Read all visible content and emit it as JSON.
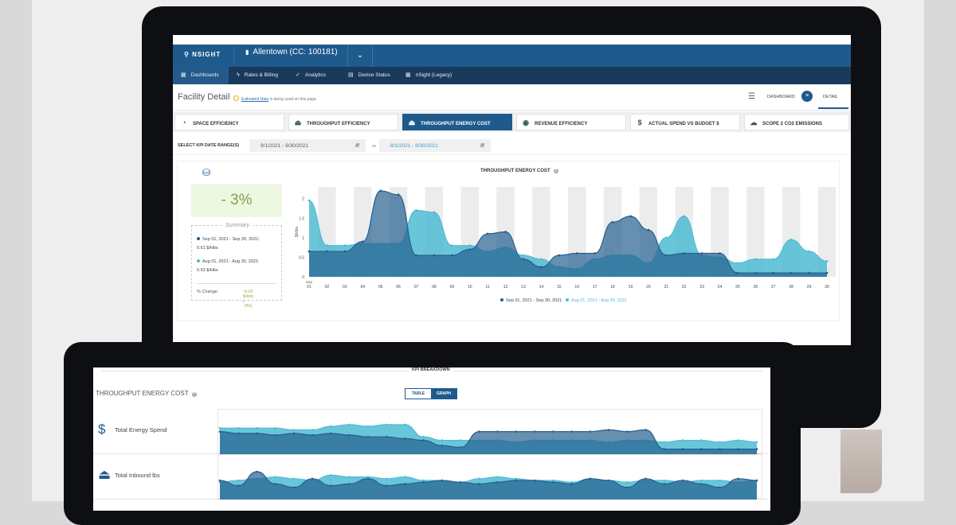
{
  "topbar": {
    "brand": "NSIGHT",
    "facility": "Allentown (CC: 100181)"
  },
  "nav": [
    {
      "label": "Dashboards",
      "active": true
    },
    {
      "label": "Rates & Billing"
    },
    {
      "label": "Analytics"
    },
    {
      "label": "Device Status"
    },
    {
      "label": "nSight (Legacy)"
    }
  ],
  "page": {
    "title": "Facility Detail",
    "estimated_link": "Estimated Data",
    "estimated_rest": " is being used on this page.",
    "dashboard": "DASHBOARD",
    "detail": "DETAIL"
  },
  "kpi_tabs": [
    {
      "label": "SPACE EFFICIENCY",
      "icon": "gauge-icon"
    },
    {
      "label": "THROUGHPUT EFFICIENCY",
      "icon": "weight-icon"
    },
    {
      "label": "THROUGHPUT ENERGY COST",
      "icon": "weight-dollar-icon",
      "active": true
    },
    {
      "label": "REVENUE EFFICIENCY",
      "icon": "coin-icon"
    },
    {
      "label": "ACTUAL SPEND VS BUDGET $",
      "icon": "dollar-icon"
    },
    {
      "label": "SCOPE 2 CO2 EMISSIONS",
      "icon": "cloud-icon"
    }
  ],
  "date": {
    "label": "SELECT KPI DATE RANGE(S)",
    "range1": "9/1/2021  -  9/30/2021",
    "vs": "vs",
    "range2": "8/1/2021  -  8/30/2021"
  },
  "summary": {
    "change": "- 3%",
    "title": "Summary",
    "s1_range": "Sep 01, 2021 - Sep 30, 2021:",
    "s1_value": "0.61 $/klbs",
    "s2_range": "Aug 01, 2021 - Aug 30, 2021:",
    "s2_value": "0.63 $/klbs",
    "pct_label": "% Change:",
    "pct_value": "-0.02 $/kbs ( -3%)"
  },
  "colors": {
    "primary": "#1f5a8d",
    "series1": "#25608f",
    "series2": "#4fbcd2",
    "nav": "#1a3a5c"
  },
  "chart_data": {
    "type": "area",
    "title": "THROUGHPUT ENERGY COST",
    "xlabel": "",
    "ylabel": "$/klbs",
    "x": [
      "01",
      "02",
      "03",
      "04",
      "05",
      "06",
      "07",
      "08",
      "09",
      "10",
      "11",
      "12",
      "13",
      "14",
      "15",
      "16",
      "17",
      "18",
      "19",
      "20",
      "21",
      "22",
      "23",
      "24",
      "25",
      "26",
      "27",
      "28",
      "29",
      "30"
    ],
    "ylim": [
      0,
      2.3
    ],
    "yticks": [
      0,
      0.5,
      1,
      1.5,
      2
    ],
    "x_prefix": "Sep",
    "series": [
      {
        "name": "Sep 01, 2021 - Sep 30, 2021",
        "color": "#25608f",
        "values": [
          0.65,
          0.65,
          0.65,
          0.9,
          2.2,
          2.1,
          0.55,
          0.55,
          0.55,
          0.7,
          1.1,
          1.15,
          0.45,
          0.25,
          0.55,
          0.6,
          0.6,
          1.4,
          1.55,
          1.2,
          0.55,
          0.6,
          0.6,
          0.6,
          0.1,
          0.1,
          0.1,
          0.1,
          0.1,
          0.1
        ]
      },
      {
        "name": "Aug 01, 2021 - Aug 30, 2021",
        "color": "#4fbcd2",
        "values": [
          1.95,
          0.8,
          0.8,
          0.85,
          0.85,
          0.85,
          1.7,
          1.65,
          0.8,
          0.8,
          0.65,
          0.75,
          0.55,
          0.45,
          0.25,
          0.2,
          0.45,
          0.55,
          0.55,
          0.35,
          1.0,
          1.55,
          0.55,
          0.5,
          0.35,
          0.45,
          0.45,
          0.95,
          0.65,
          0.4
        ]
      }
    ],
    "legend": "bottom"
  },
  "breakdown": {
    "title": "KPI BREAKDOWN",
    "kpi": "THROUGHPUT ENERGY COST",
    "toggle_table": "TABLE",
    "toggle_graph": "GRAPH",
    "rows": [
      {
        "label": "Total Energy Spend",
        "icon": "dollar-icon",
        "s1": [
          0.6,
          0.55,
          0.55,
          0.5,
          0.55,
          0.5,
          0.55,
          0.5,
          0.45,
          0.45,
          0.4,
          0.35,
          0.2,
          0.15,
          0.6,
          0.6,
          0.6,
          0.6,
          0.6,
          0.6,
          0.6,
          0.65,
          0.6,
          0.65,
          0.1,
          0.1,
          0.1,
          0.1,
          0.1,
          0.1
        ],
        "s2": [
          0.7,
          0.7,
          0.7,
          0.7,
          0.65,
          0.65,
          0.75,
          0.8,
          0.75,
          0.8,
          0.8,
          0.45,
          0.35,
          0.35,
          0.35,
          0.35,
          0.3,
          0.35,
          0.35,
          0.35,
          0.35,
          0.3,
          0.35,
          0.35,
          0.3,
          0.35,
          0.35,
          0.3,
          0.35,
          0.3
        ]
      },
      {
        "label": "Total Inbound lbs",
        "icon": "weight-arrow-icon",
        "s1": [
          0.5,
          0.35,
          0.75,
          0.4,
          0.3,
          0.55,
          0.35,
          0.4,
          0.55,
          0.35,
          0.4,
          0.45,
          0.5,
          0.45,
          0.4,
          0.45,
          0.5,
          0.5,
          0.45,
          0.4,
          0.55,
          0.5,
          0.3,
          0.55,
          0.4,
          0.5,
          0.4,
          0.3,
          0.55,
          0.5
        ],
        "s2": [
          0.45,
          0.5,
          0.55,
          0.6,
          0.55,
          0.5,
          0.65,
          0.6,
          0.6,
          0.55,
          0.6,
          0.5,
          0.5,
          0.45,
          0.55,
          0.6,
          0.55,
          0.5,
          0.5,
          0.45,
          0.55,
          0.5,
          0.45,
          0.5,
          0.5,
          0.45,
          0.5,
          0.5,
          0.45,
          0.5
        ]
      }
    ]
  }
}
